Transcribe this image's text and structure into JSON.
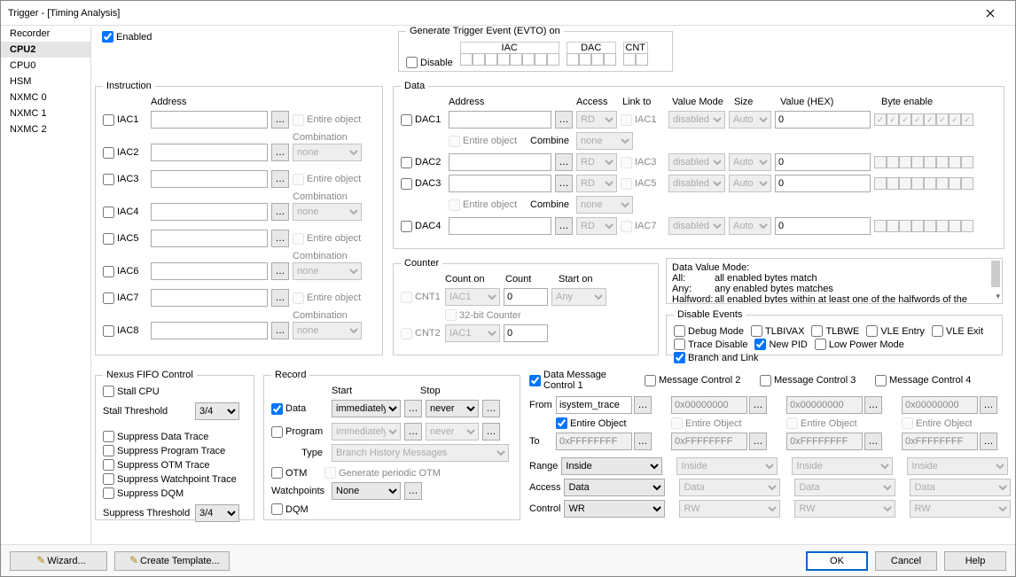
{
  "title": "Trigger - [Timing Analysis]",
  "sidebar": {
    "items": [
      {
        "label": "Recorder"
      },
      {
        "label": "CPU2"
      },
      {
        "label": "CPU0"
      },
      {
        "label": "HSM"
      },
      {
        "label": "NXMC 0"
      },
      {
        "label": "NXMC 1"
      },
      {
        "label": "NXMC 2"
      }
    ],
    "selected": 1
  },
  "enabled_label": "Enabled",
  "evto": {
    "title": "Generate Trigger Event (EVTO) on",
    "disable": "Disable",
    "iac": "IAC",
    "dac": "DAC",
    "cnt": "CNT"
  },
  "instruction": {
    "title": "Instruction",
    "address": "Address",
    "entire_object": "Entire object",
    "combination": "Combination",
    "rows": [
      "IAC1",
      "IAC2",
      "IAC3",
      "IAC4",
      "IAC5",
      "IAC6",
      "IAC7",
      "IAC8"
    ],
    "combo_val": "none"
  },
  "data": {
    "title": "Data",
    "address": "Address",
    "access": "Access",
    "linkto": "Link to",
    "valuemode": "Value Mode",
    "size": "Size",
    "valuehex": "Value (HEX)",
    "byteen": "Byte enable",
    "entire_object": "Entire object",
    "combine": "Combine",
    "rows": [
      {
        "name": "DAC1",
        "acc": "RD",
        "link": "IAC1",
        "vm": "disabled",
        "sz": "Auto",
        "val": "0"
      },
      {
        "name": "DAC2",
        "acc": "RD",
        "link": "IAC3",
        "vm": "disabled",
        "sz": "Auto",
        "val": "0"
      },
      {
        "name": "DAC3",
        "acc": "RD",
        "link": "IAC5",
        "vm": "disabled",
        "sz": "Auto",
        "val": "0"
      },
      {
        "name": "DAC4",
        "acc": "RD",
        "link": "IAC7",
        "vm": "disabled",
        "sz": "Auto",
        "val": "0"
      }
    ],
    "combine_val": "none"
  },
  "counter": {
    "title": "Counter",
    "count_on": "Count on",
    "count": "Count",
    "start_on": "Start on",
    "cnt1": "CNT1",
    "cnt2": "CNT2",
    "iac1": "IAC1",
    "zero": "0",
    "any": "Any",
    "bit32": "32-bit Counter"
  },
  "info": {
    "l1": "Data Value Mode:",
    "l2a": "All:",
    "l2b": "all enabled bytes match",
    "l3a": "Any:",
    "l3b": "any enabled bytes matches",
    "l4a": "Halfword:",
    "l4b": "all enabled bytes within at least one of the halfwords of the"
  },
  "disable_events": {
    "title": "Disable Events",
    "items": [
      "Debug Mode",
      "TLBIVAX",
      "TLBWE",
      "VLE Entry",
      "VLE Exit",
      "Trace Disable",
      "New PID",
      "Low Power Mode",
      "Branch and Link"
    ],
    "checked": {
      "New PID": true,
      "Branch and Link": true
    }
  },
  "nexus": {
    "title": "Nexus FIFO Control",
    "stall_cpu": "Stall CPU",
    "stall_thr": "Stall Threshold",
    "stall_val": "3/4",
    "sdt": "Suppress Data Trace",
    "spt": "Suppress Program Trace",
    "sot": "Suppress OTM Trace",
    "swt": "Suppress Watchpoint Trace",
    "sdq": "Suppress DQM",
    "sup_thr": "Suppress Threshold",
    "sup_val": "3/4"
  },
  "record": {
    "title": "Record",
    "start": "Start",
    "stop": "Stop",
    "data": "Data",
    "program": "Program",
    "type": "Type",
    "imm": "immediately",
    "never": "never",
    "type_val": "Branch History Messages",
    "otm": "OTM",
    "gen_otm": "Generate periodic OTM",
    "wp": "Watchpoints",
    "wp_val": "None",
    "dqm": "DQM"
  },
  "msgctrl": {
    "labels": [
      "Data Message Control 1",
      "Message Control 2",
      "Message Control 3",
      "Message Control 4"
    ],
    "from": "From",
    "to": "To",
    "range": "Range",
    "access": "Access",
    "control": "Control",
    "entire_object": "Entire Object",
    "cols": [
      {
        "from": "isystem_trace",
        "eo": true,
        "to": "0xFFFFFFFF",
        "range": "Inside",
        "acc": "Data",
        "ctl": "WR",
        "enabled": true
      },
      {
        "from": "0x00000000",
        "eo": false,
        "to": "0xFFFFFFFF",
        "range": "Inside",
        "acc": "Data",
        "ctl": "RW",
        "enabled": false
      },
      {
        "from": "0x00000000",
        "eo": false,
        "to": "0xFFFFFFFF",
        "range": "Inside",
        "acc": "Data",
        "ctl": "RW",
        "enabled": false
      },
      {
        "from": "0x00000000",
        "eo": false,
        "to": "0xFFFFFFFF",
        "range": "Inside",
        "acc": "Data",
        "ctl": "RW",
        "enabled": false
      }
    ]
  },
  "footer": {
    "wizard": "Wizard...",
    "tmpl": "Create Template...",
    "ok": "OK",
    "cancel": "Cancel",
    "help": "Help"
  }
}
